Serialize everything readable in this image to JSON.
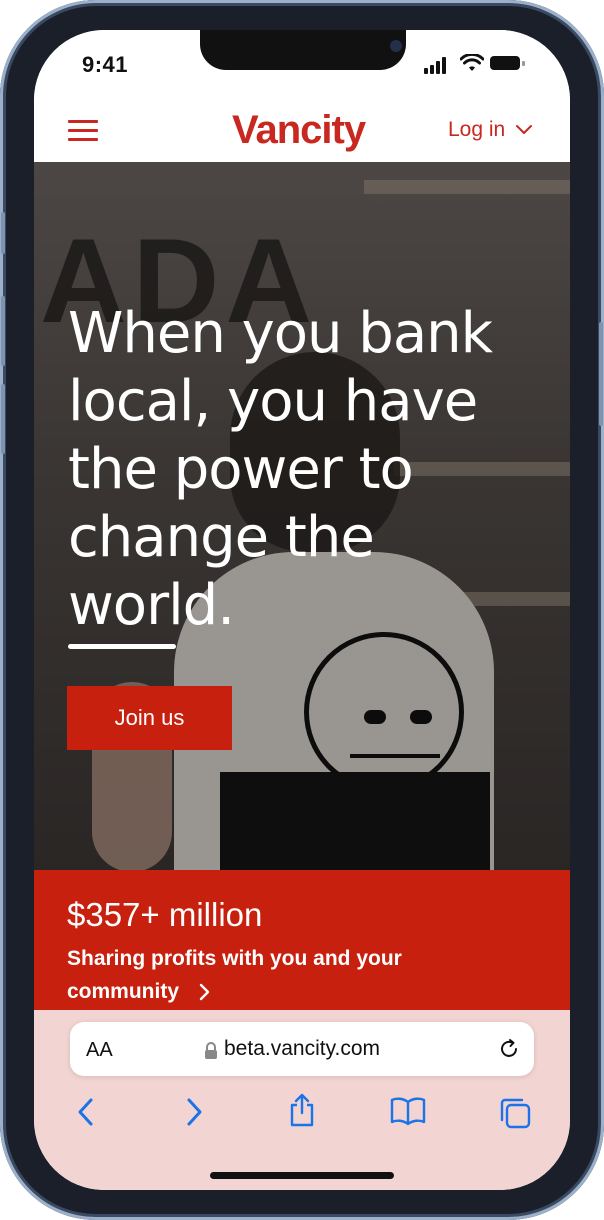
{
  "status": {
    "time": "9:41"
  },
  "header": {
    "logo": "Vancity",
    "login_label": "Log in"
  },
  "hero": {
    "headline_lines": [
      "When you bank",
      "local, you have",
      "the power to",
      "change the",
      "world."
    ],
    "cta_label": "Join us"
  },
  "promo": {
    "amount": "$357+ million",
    "text": "Sharing profits with you and your community"
  },
  "browser": {
    "aa_label": "AA",
    "url": "beta.vancity.com"
  },
  "colors": {
    "brand_red": "#c8200f",
    "browser_bar": "#f2d4d2",
    "ios_blue": "#1a73e8"
  },
  "icons": [
    "hamburger-menu-icon",
    "chevron-down-icon",
    "chevron-right-icon",
    "lock-icon",
    "reload-icon",
    "back-icon",
    "forward-icon",
    "share-icon",
    "bookmarks-icon",
    "tabs-icon"
  ]
}
